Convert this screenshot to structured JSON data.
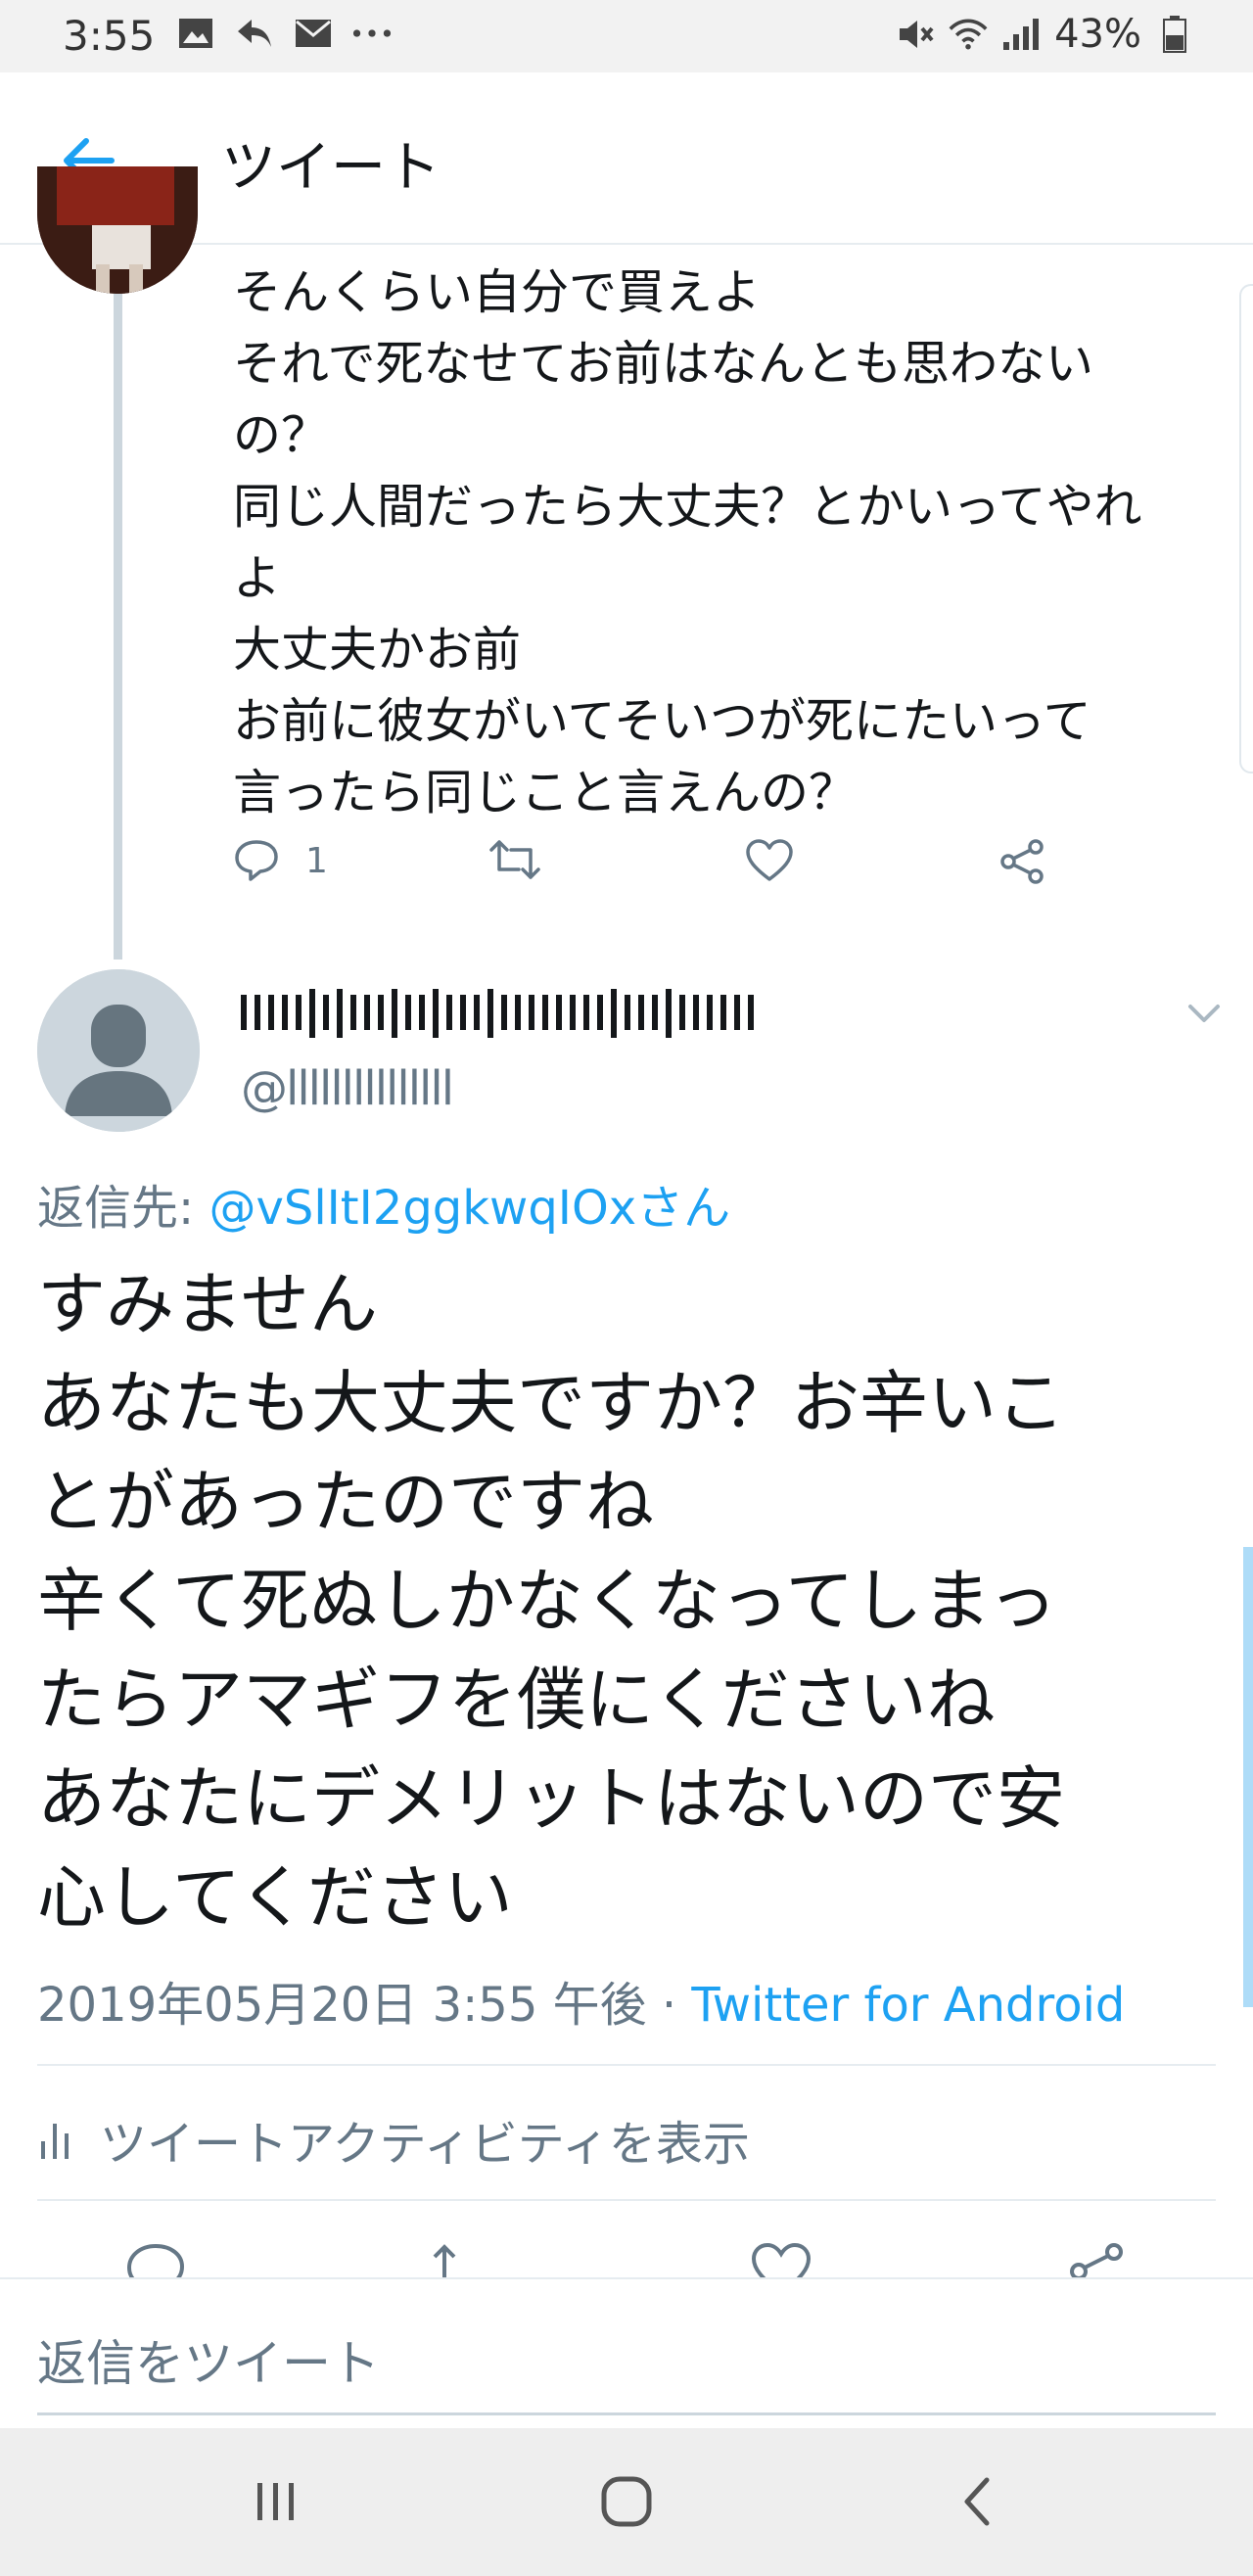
{
  "status_bar": {
    "time": "3:55",
    "battery": "43%"
  },
  "header": {
    "title": "ツイート"
  },
  "previous_tweet": {
    "lines": [
      "そんくらい自分で買えよ",
      "それで死なせてお前はなんとも思わない",
      "の？",
      "同じ人間だったら大丈夫？とかいってやれ",
      "よ",
      "大丈夫かお前",
      "お前に彼女がいてそいつが死にたいって",
      "言ったら同じこと言えんの？"
    ],
    "reply_count": "1"
  },
  "main_tweet": {
    "handle": "@lllllllllllllll",
    "reply_to_label": "返信先: ",
    "reply_to_mention": "@vSlItI2ggkwqIOxさん",
    "text_lines": [
      "すみません",
      "あなたも大丈夫ですか？お辛いこ",
      "とがあったのですね",
      "辛くて死ぬしかなくなってしまっ",
      "たらアマギフを僕にくださいね",
      "あなたにデメリットはないので安",
      "心してください"
    ],
    "timestamp": "2019年05月20日 3:55 午後 · ",
    "source": "Twitter for Android",
    "activity_label": "ツイートアクティビティを表示"
  },
  "reply_bar": {
    "placeholder": "返信をツイート"
  },
  "colors": {
    "accent": "#1da1f2",
    "secondary_text": "#657786",
    "primary_text": "#14171a",
    "divider": "#e6ecf0"
  }
}
